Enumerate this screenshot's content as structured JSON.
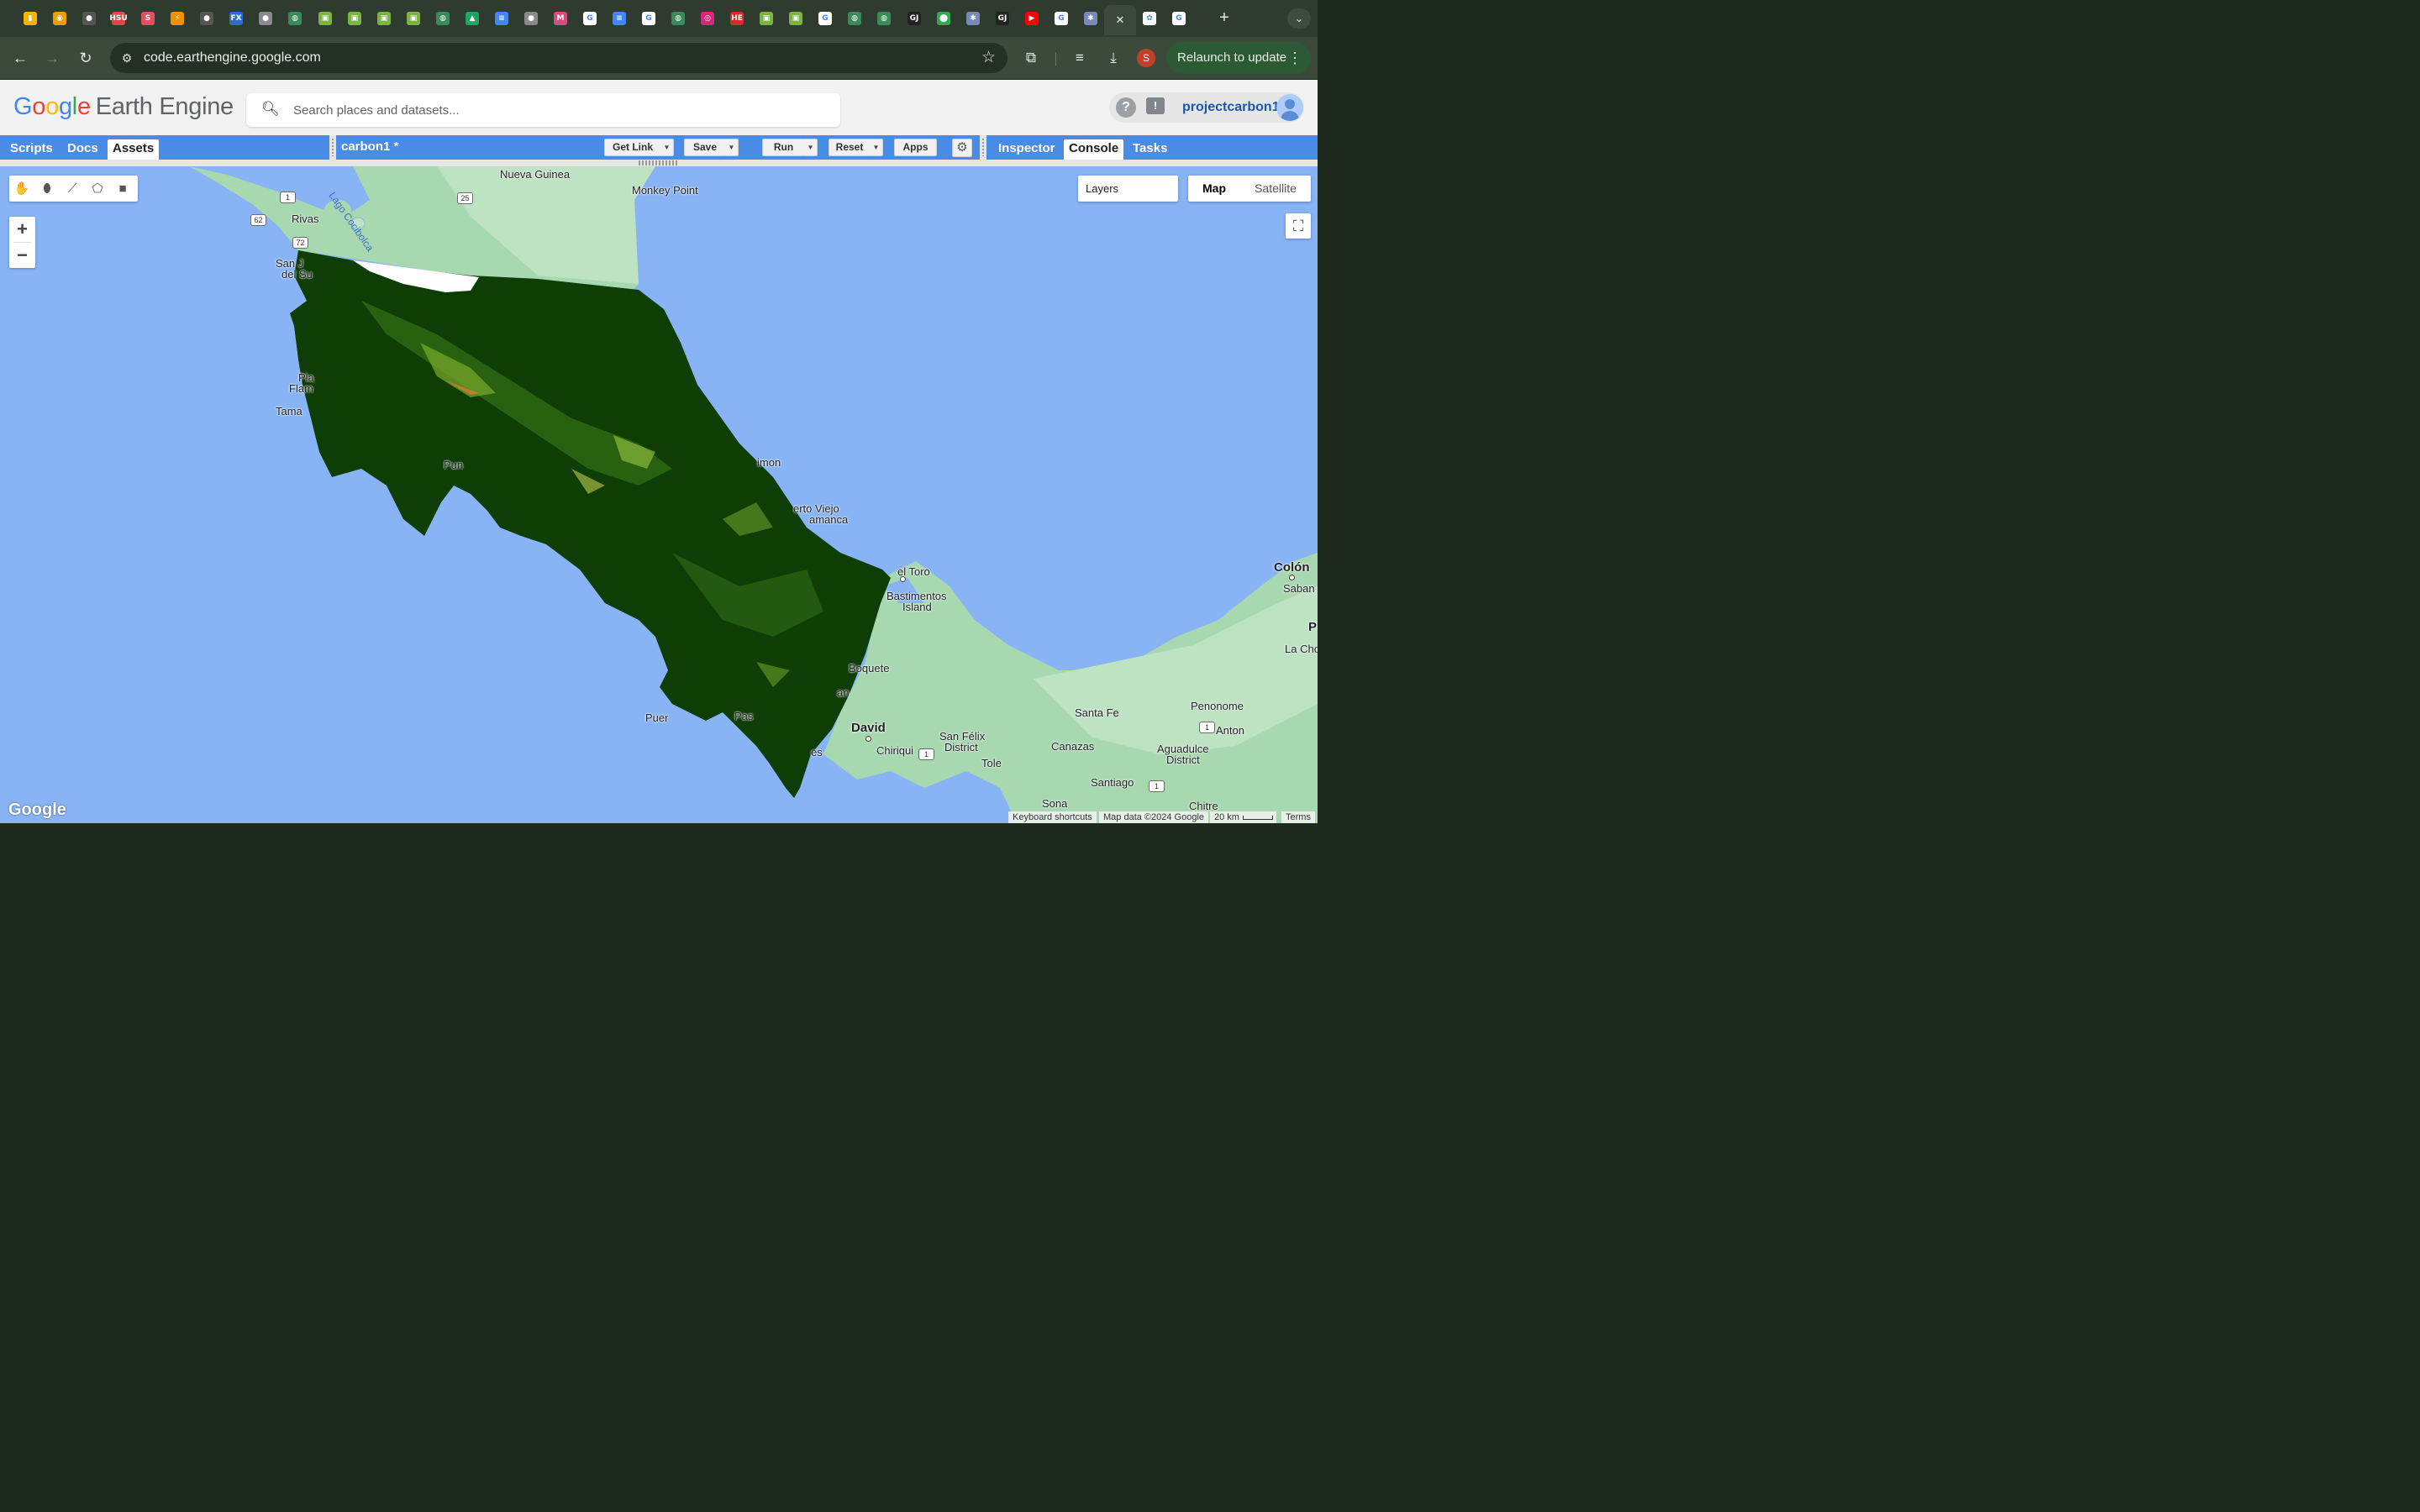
{
  "browser": {
    "tabs": [
      {
        "icon": "chart-icon",
        "color": "#f4b400",
        "glyph": "▮"
      },
      {
        "icon": "compass-icon",
        "color": "#e6a100",
        "glyph": "◉"
      },
      {
        "icon": "github-icon",
        "color": "#555555",
        "glyph": "●"
      },
      {
        "icon": "hsu-icon",
        "color": "#d94b4b",
        "glyph": "HSU"
      },
      {
        "icon": "s-icon",
        "color": "#e05260",
        "glyph": "S"
      },
      {
        "icon": "bolt-icon",
        "color": "#f29100",
        "glyph": "⚡"
      },
      {
        "icon": "github-icon",
        "color": "#555555",
        "glyph": "●"
      },
      {
        "icon": "fx-icon",
        "color": "#2e6bd1",
        "glyph": "FX"
      },
      {
        "icon": "globe-icon",
        "color": "#8a8a8a",
        "glyph": "●"
      },
      {
        "icon": "earth-engine-icon",
        "color": "#3a8a5a",
        "glyph": "◍"
      },
      {
        "icon": "leaf-icon",
        "color": "#7cb342",
        "glyph": "▣"
      },
      {
        "icon": "leaf-icon",
        "color": "#7cb342",
        "glyph": "▣"
      },
      {
        "icon": "leaf-icon",
        "color": "#7cb342",
        "glyph": "▣"
      },
      {
        "icon": "leaf-icon",
        "color": "#7cb342",
        "glyph": "▣"
      },
      {
        "icon": "earth-engine-icon",
        "color": "#3a8a5a",
        "glyph": "◍"
      },
      {
        "icon": "drive-icon",
        "color": "#1fa463",
        "glyph": "▲"
      },
      {
        "icon": "docs-icon",
        "color": "#4285f4",
        "glyph": "≡"
      },
      {
        "icon": "globe-icon",
        "color": "#8a8a8a",
        "glyph": "●"
      },
      {
        "icon": "m-icon",
        "color": "#d64a7e",
        "glyph": "M"
      },
      {
        "icon": "google-icon",
        "color": "#ffffff",
        "glyph": "G"
      },
      {
        "icon": "docs-icon",
        "color": "#4285f4",
        "glyph": "≡"
      },
      {
        "icon": "google-icon",
        "color": "#ffffff",
        "glyph": "G"
      },
      {
        "icon": "earth-engine-icon",
        "color": "#3a8a5a",
        "glyph": "◍"
      },
      {
        "icon": "instagram-icon",
        "color": "#d62976",
        "glyph": "◎"
      },
      {
        "icon": "hema-icon",
        "color": "#d62b2b",
        "glyph": "HE"
      },
      {
        "icon": "leaf-icon",
        "color": "#7cb342",
        "glyph": "▣"
      },
      {
        "icon": "leaf-icon",
        "color": "#7cb342",
        "glyph": "▣"
      },
      {
        "icon": "google-icon",
        "color": "#ffffff",
        "glyph": "G"
      },
      {
        "icon": "earth-engine-icon",
        "color": "#3a8a5a",
        "glyph": "◍"
      },
      {
        "icon": "earth-engine-icon",
        "color": "#3a8a5a",
        "glyph": "◍"
      },
      {
        "icon": "gj-icon",
        "color": "#222222",
        "glyph": "GJ"
      },
      {
        "icon": "maps-pin-icon",
        "color": "#34a853",
        "glyph": "⬤"
      },
      {
        "icon": "puzzle-icon",
        "color": "#7a8ab8",
        "glyph": "✱"
      },
      {
        "icon": "gj-icon",
        "color": "#222222",
        "glyph": "GJ"
      },
      {
        "icon": "youtube-icon",
        "color": "#ff0000",
        "glyph": "▶"
      },
      {
        "icon": "google-icon",
        "color": "#ffffff",
        "glyph": "G"
      },
      {
        "icon": "puzzle-icon",
        "color": "#7a8ab8",
        "glyph": "✱"
      },
      {
        "icon": "close-icon",
        "color": "#3c4a3c",
        "glyph": "✕"
      },
      {
        "icon": "openai-icon",
        "color": "#ffffff",
        "glyph": "✿"
      },
      {
        "icon": "google-icon",
        "color": "#ffffff",
        "glyph": "G"
      }
    ],
    "url": "code.earthengine.google.com",
    "profile_initial": "S",
    "relaunch_label": "Relaunch to update"
  },
  "gee": {
    "logo_google": [
      "G",
      "o",
      "o",
      "g",
      "l",
      "e"
    ],
    "logo_product": "Earth Engine",
    "search_placeholder": "Search places and datasets...",
    "project": "projectcarbon1",
    "left_tabs": [
      "Scripts",
      "Docs",
      "Assets"
    ],
    "left_selected": "Assets",
    "script_title": "carbon1 *",
    "buttons": {
      "get_link": "Get Link",
      "save": "Save",
      "run": "Run",
      "reset": "Reset",
      "apps": "Apps"
    },
    "right_tabs": [
      "Inspector",
      "Console",
      "Tasks"
    ],
    "right_selected": "Console"
  },
  "map": {
    "layers_label": "Layers",
    "map_types": [
      "Map",
      "Satellite"
    ],
    "map_type_selected": "Map",
    "zoom_in": "+",
    "zoom_out": "−",
    "watermark": "Google",
    "keyboard_shortcuts": "Keyboard shortcuts",
    "map_data": "Map data ©2024 Google",
    "scale": "20 km",
    "terms": "Terms",
    "place_labels": [
      "Nueva Guinea",
      "Monkey Point",
      "Rivas",
      "San J",
      "del Su",
      "Pla",
      "Flam",
      "Tama",
      "Pun",
      "imon",
      "erto Viejo",
      "amanca",
      "el Toro",
      "Bastimentos",
      "Island",
      "Boquete",
      "an",
      "David",
      "Chiriqui",
      "San Félix",
      "District",
      "Pas",
      "Puer",
      "es",
      "Colón",
      "Saban",
      "P",
      "La Cho",
      "Penonome",
      "Anton",
      "Santa Fe",
      "Canazas",
      "Aguadulce",
      "District",
      "Tole",
      "Santiago",
      "Sona",
      "Chitre",
      "Lago Cocibolca"
    ],
    "route_shields": [
      "1",
      "62",
      "25",
      "72",
      "1",
      "1",
      "1"
    ]
  },
  "colors": {
    "browser_dark": "#2f3b2f",
    "gee_blue": "#4a8be6",
    "water": "#88b4f5",
    "land": "#a8d8b0",
    "vegetation_dark": "#0e3d06"
  }
}
